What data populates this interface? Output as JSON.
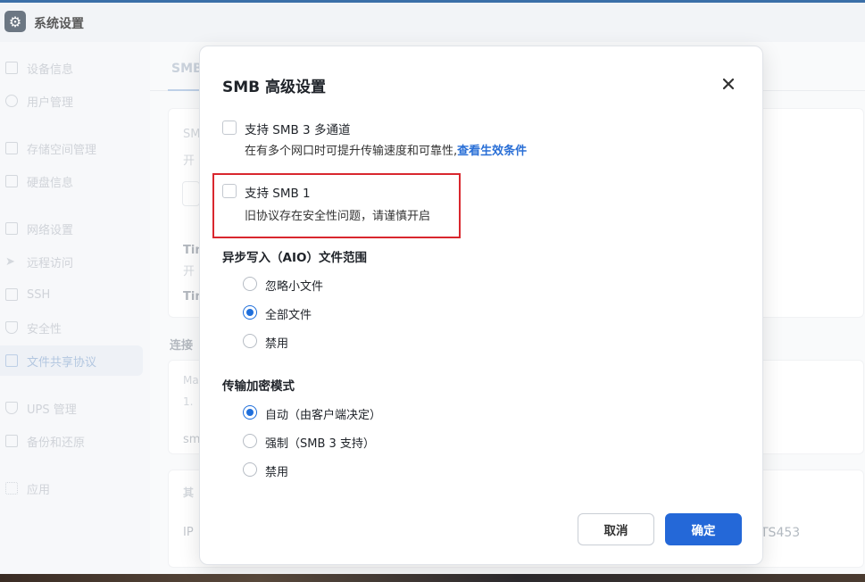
{
  "app": {
    "title": "系统设置",
    "icon": "gear-icon"
  },
  "sidebar": {
    "items": [
      {
        "label": "设备信息",
        "icon": "device-icon"
      },
      {
        "label": "用户管理",
        "icon": "user-icon"
      },
      {
        "label": "存储空间管理",
        "icon": "storage-icon"
      },
      {
        "label": "硬盘信息",
        "icon": "disk-icon"
      },
      {
        "label": "网络设置",
        "icon": "network-icon"
      },
      {
        "label": "远程访问",
        "icon": "remote-icon"
      },
      {
        "label": "SSH",
        "icon": "ssh-icon"
      },
      {
        "label": "安全性",
        "icon": "shield-icon"
      },
      {
        "label": "文件共享协议",
        "icon": "file-share-icon"
      },
      {
        "label": "UPS 管理",
        "icon": "ups-icon"
      },
      {
        "label": "备份和还原",
        "icon": "backup-icon"
      },
      {
        "label": "应用",
        "icon": "apps-icon"
      }
    ]
  },
  "background": {
    "tab_label": "SMB",
    "frag_smb": "SM",
    "frag_kai1": "开",
    "frag_tim1": "Tim",
    "frag_kai2": "开",
    "frag_tim2": "Tim",
    "frag_lianjie": "连接",
    "frag_ma": "Ma",
    "frag_one": "1.",
    "frag_sm": "sm",
    "frag_qi": "其",
    "frag_ip": "IP",
    "device_name": "TS453"
  },
  "dialog": {
    "title": "SMB 高级设置",
    "multichannel": {
      "label": "支持 SMB 3 多通道",
      "desc": "在有多个网口时可提升传输速度和可靠性,",
      "link": "查看生效条件",
      "checked": false
    },
    "smb1": {
      "label": "支持 SMB 1",
      "desc": "旧协议存在安全性问题，请谨慎开启",
      "checked": false
    },
    "aio": {
      "title": "异步写入（AIO）文件范围",
      "options": [
        "忽略小文件",
        "全部文件",
        "禁用"
      ],
      "selected": "全部文件"
    },
    "encryption": {
      "title": "传输加密模式",
      "options": [
        "自动（由客户端决定）",
        "强制（SMB 3 支持）",
        "禁用"
      ],
      "selected": "自动（由客户端决定）"
    },
    "cancel_label": "取消",
    "ok_label": "确定"
  },
  "colors": {
    "accent": "#2468d8",
    "highlight": "#d9272e",
    "link": "#2a6fd6"
  }
}
